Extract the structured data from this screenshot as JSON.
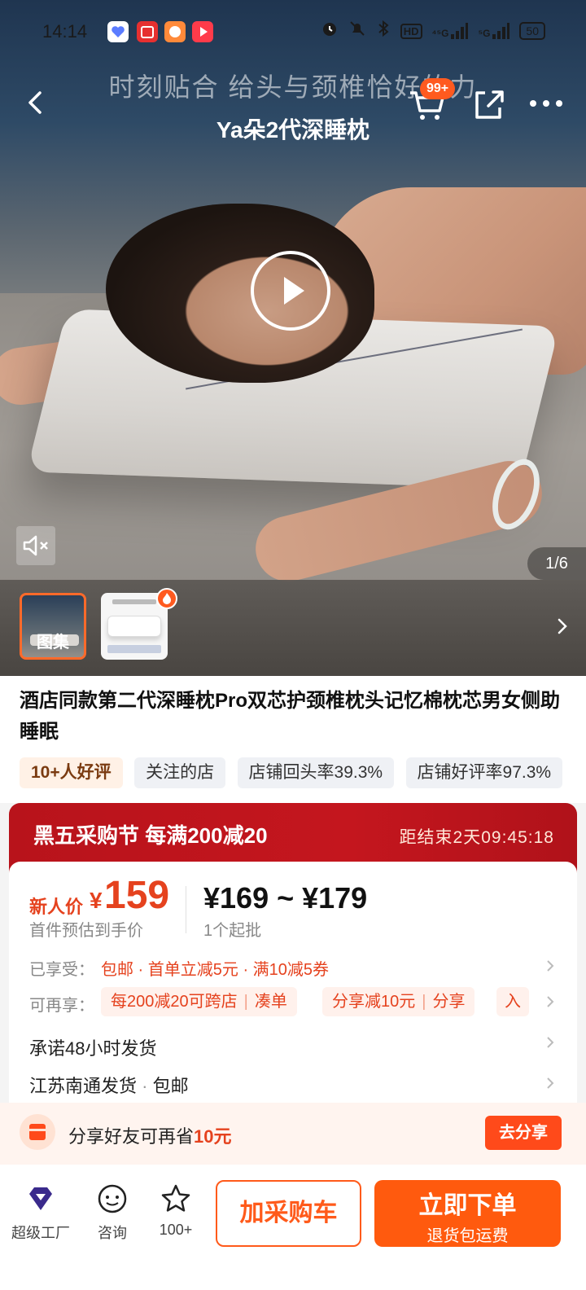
{
  "status_bar": {
    "time": "14:14",
    "network_a": "⁴⁵G",
    "network_b": "⁵G",
    "hd_label": "HD",
    "battery": "50"
  },
  "hero": {
    "slogan": "时刻贴合  给头与颈椎恰好的力",
    "product_overlay_name": "Ya朵2代深睡枕",
    "cart_badge": "99+",
    "page_counter": "1/6",
    "gallery_label": "图集"
  },
  "product": {
    "title": "酒店同款第二代深睡枕Pro双芯护颈椎枕头记忆棉枕芯男女侧助睡眠",
    "tags": [
      {
        "label": "10+人好评",
        "hot": true
      },
      {
        "label": "关注的店",
        "hot": false
      },
      {
        "label": "店铺回头率39.3%",
        "hot": false
      },
      {
        "label": "店铺好评率97.3%",
        "hot": false
      }
    ]
  },
  "promotion": {
    "title": "黑五采购节 每满200减20",
    "countdown": "距结束2天09:45:18"
  },
  "price": {
    "new_user_label": "新人价",
    "currency": "¥",
    "new_user_price": "159",
    "new_user_sub": "首件预估到手价",
    "range": "¥169 ~ ¥179",
    "min_batch": "1个起批"
  },
  "benefits": {
    "enjoyed_label": "已享受：",
    "enjoyed_value": "包邮 · 首单立减5元 · 满10减5券",
    "more_label": "可再享：",
    "chip1_left": "每200减20可跨店",
    "chip1_right": "凑单",
    "chip2_left": "分享减10元",
    "chip2_right": "分享",
    "chip3": "入"
  },
  "shipping": {
    "promise": "承诺48小时发货",
    "origin": "江苏南通发货",
    "origin_sep": " · ",
    "free_ship": "包邮"
  },
  "share_bar": {
    "text_prefix": "分享好友可再省",
    "amount": "10元",
    "button": "去分享"
  },
  "bottom_bar": {
    "factory": "超级工厂",
    "consult": "咨询",
    "favorites": "100+",
    "add_cart": "加采购车",
    "buy_now": "立即下单",
    "buy_now_sub": "退货包运费"
  },
  "colors": {
    "accent": "#ff5a0e",
    "price_red": "#e5421e",
    "promo_red": "#c4161e"
  }
}
